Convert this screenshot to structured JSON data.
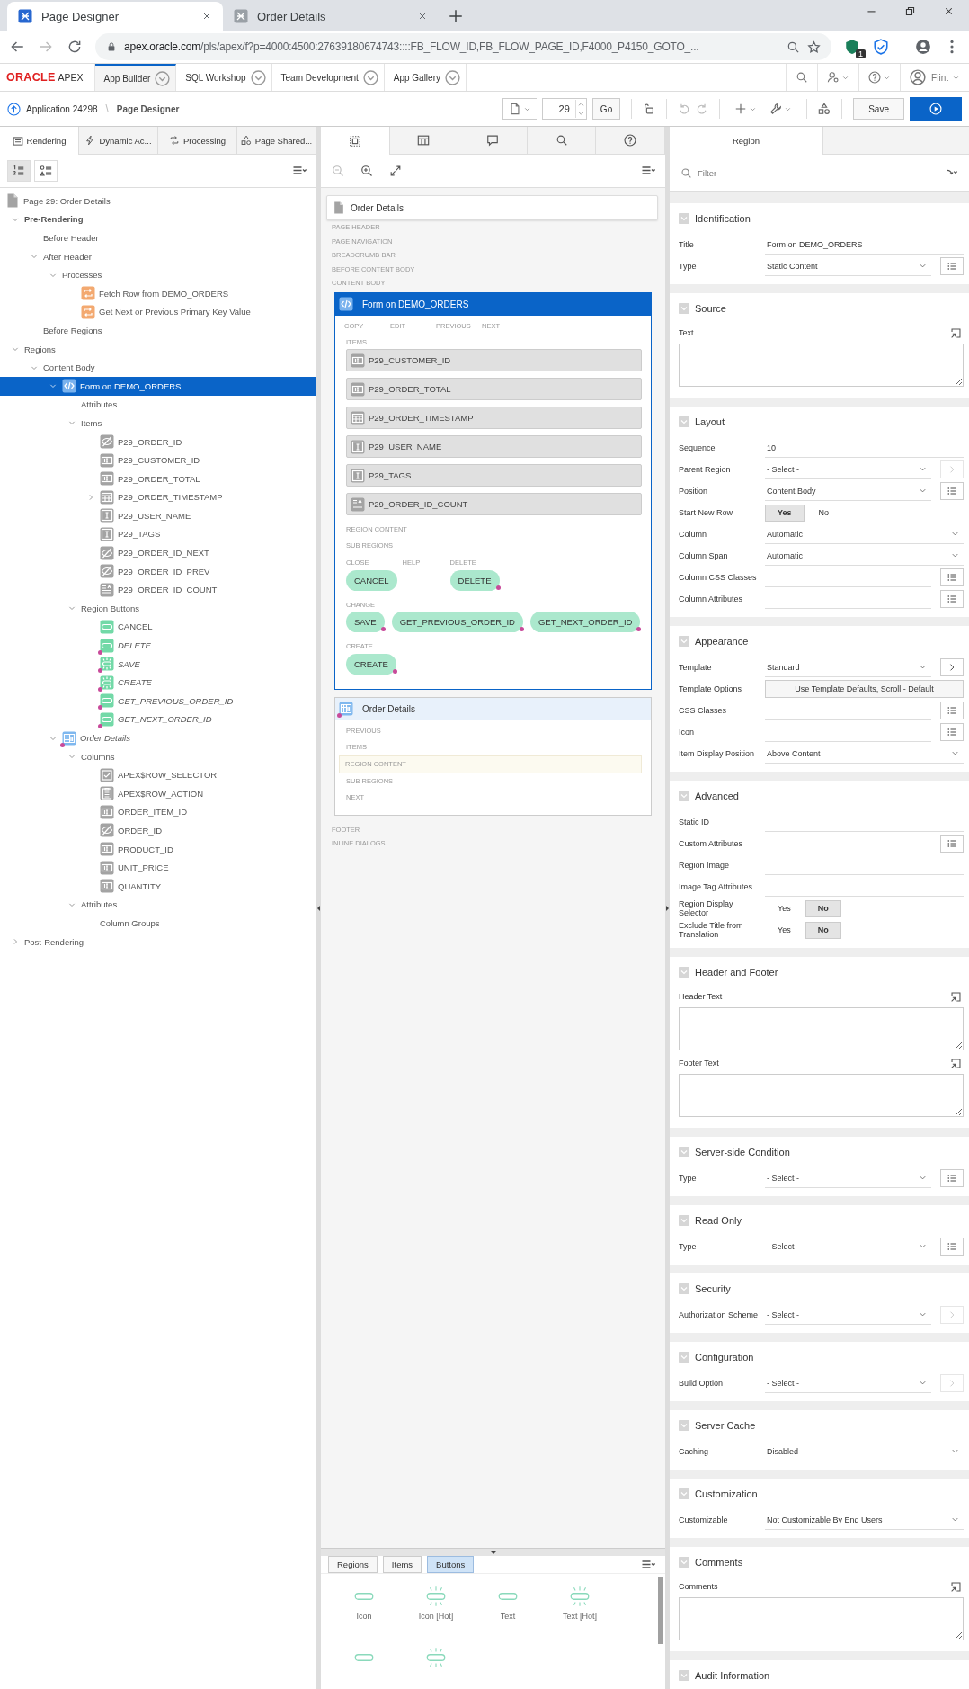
{
  "browser": {
    "tabs": [
      {
        "title": "Page Designer",
        "selected": true
      },
      {
        "title": "Order Details",
        "selected": false
      }
    ],
    "url_host": "apex.oracle.com",
    "url_path": "/pls/apex/f?p=4000:4500:27639180674743::::FB_FLOW_ID,FB_FLOW_PAGE_ID,F4000_P4150_GOTO_...",
    "extension_badge": "1"
  },
  "header": {
    "logo_brand": "ORACLE",
    "logo_product": "APEX",
    "menus": [
      {
        "label": "App Builder",
        "selected": true
      },
      {
        "label": "SQL Workshop",
        "selected": false
      },
      {
        "label": "Team Development",
        "selected": false
      },
      {
        "label": "App Gallery",
        "selected": false
      }
    ],
    "user": "Flint"
  },
  "toolbar": {
    "breadcrumb": [
      "Application 24298",
      "Page Designer"
    ],
    "separator": "\\",
    "page_number": "29",
    "go": "Go",
    "save": "Save"
  },
  "left": {
    "tabs": [
      {
        "label": "Rendering",
        "selected": true
      },
      {
        "label": "Dynamic Ac...",
        "selected": false
      },
      {
        "label": "Processing",
        "selected": false
      },
      {
        "label": "Page Shared...",
        "selected": false
      }
    ],
    "views": [
      {
        "selected": true
      },
      {
        "selected": false
      }
    ],
    "page": {
      "label": "Page 29: Order Details"
    },
    "tree": [
      {
        "label": "Pre-Rendering",
        "bold": true,
        "expanded": true,
        "selected": false,
        "children": [
          {
            "label": "Before Header",
            "selected": false
          },
          {
            "label": "After Header",
            "expanded": true,
            "selected": false,
            "children": [
              {
                "label": "Processes",
                "expanded": true,
                "selected": false,
                "children": [
                  {
                    "label": "Fetch Row from DEMO_ORDERS",
                    "kind": "process",
                    "selected": false
                  },
                  {
                    "label": "Get Next or Previous Primary Key Value",
                    "kind": "process",
                    "selected": false
                  }
                ]
              }
            ]
          },
          {
            "label": "Before Regions",
            "selected": false
          }
        ]
      },
      {
        "label": "Regions",
        "expanded": true,
        "selected": false,
        "children": [
          {
            "label": "Content Body",
            "expanded": true,
            "selected": false,
            "children": [
              {
                "label": "Form on DEMO_ORDERS",
                "kind": "code",
                "expanded": true,
                "selected": true,
                "children": [
                  {
                    "label": "Attributes",
                    "selected": false
                  },
                  {
                    "label": "Items",
                    "expanded": true,
                    "selected": false,
                    "children": [
                      {
                        "label": "P29_ORDER_ID",
                        "kind": "hidden",
                        "selected": false
                      },
                      {
                        "label": "P29_CUSTOMER_ID",
                        "kind": "number",
                        "selected": false
                      },
                      {
                        "label": "P29_ORDER_TOTAL",
                        "kind": "number",
                        "selected": false
                      },
                      {
                        "label": "P29_ORDER_TIMESTAMP",
                        "kind": "date",
                        "expanded": false,
                        "selected": false
                      },
                      {
                        "label": "P29_USER_NAME",
                        "kind": "text",
                        "selected": false
                      },
                      {
                        "label": "P29_TAGS",
                        "kind": "text",
                        "selected": false
                      },
                      {
                        "label": "P29_ORDER_ID_NEXT",
                        "kind": "hidden",
                        "selected": false
                      },
                      {
                        "label": "P29_ORDER_ID_PREV",
                        "kind": "hidden",
                        "selected": false
                      },
                      {
                        "label": "P29_ORDER_ID_COUNT",
                        "kind": "textarea",
                        "selected": false
                      }
                    ]
                  },
                  {
                    "label": "Region Buttons",
                    "expanded": true,
                    "selected": false,
                    "children": [
                      {
                        "label": "CANCEL",
                        "kind": "button",
                        "flag": false,
                        "selected": false
                      },
                      {
                        "label": "DELETE",
                        "kind": "button",
                        "flag": true,
                        "selected": false
                      },
                      {
                        "label": "SAVE",
                        "kind": "button-hot",
                        "flag": true,
                        "selected": false
                      },
                      {
                        "label": "CREATE",
                        "kind": "button-hot",
                        "flag": true,
                        "selected": false
                      },
                      {
                        "label": "GET_PREVIOUS_ORDER_ID",
                        "kind": "button",
                        "flag": true,
                        "selected": false
                      },
                      {
                        "label": "GET_NEXT_ORDER_ID",
                        "kind": "button",
                        "flag": true,
                        "selected": false
                      }
                    ]
                  }
                ]
              },
              {
                "label": "Order Details",
                "kind": "grid",
                "flag": true,
                "expanded": true,
                "selected": false,
                "children": [
                  {
                    "label": "Columns",
                    "expanded": true,
                    "selected": false,
                    "children": [
                      {
                        "label": "APEX$ROW_SELECTOR",
                        "kind": "checkbox",
                        "selected": false
                      },
                      {
                        "label": "APEX$ROW_ACTION",
                        "kind": "action",
                        "selected": false
                      },
                      {
                        "label": "ORDER_ITEM_ID",
                        "kind": "number",
                        "selected": false
                      },
                      {
                        "label": "ORDER_ID",
                        "kind": "hidden",
                        "selected": false
                      },
                      {
                        "label": "PRODUCT_ID",
                        "kind": "number",
                        "selected": false
                      },
                      {
                        "label": "UNIT_PRICE",
                        "kind": "number",
                        "selected": false
                      },
                      {
                        "label": "QUANTITY",
                        "kind": "number",
                        "selected": false
                      }
                    ]
                  },
                  {
                    "label": "Attributes",
                    "expanded": true,
                    "selected": false,
                    "children": [
                      {
                        "label": "Column Groups",
                        "selected": false
                      }
                    ]
                  }
                ]
              }
            ]
          }
        ]
      },
      {
        "label": "Post-Rendering",
        "expanded": false,
        "selected": false
      }
    ]
  },
  "middle": {
    "tabs": [
      {
        "selected": true
      },
      {
        "selected": false
      },
      {
        "selected": false
      },
      {
        "selected": false
      },
      {
        "selected": false
      }
    ],
    "page_box": "Order Details",
    "positions_top": [
      "PAGE HEADER",
      "PAGE NAVIGATION",
      "BREADCRUMB BAR",
      "BEFORE CONTENT BODY",
      "CONTENT BODY"
    ],
    "regions": [
      {
        "title": "Form on DEMO_ORDERS",
        "kind": "code",
        "selected": true,
        "flag": false,
        "top_positions": [
          "COPY",
          "EDIT",
          "PREVIOUS",
          "NEXT"
        ],
        "items_label": "ITEMS",
        "items": [
          {
            "label": "P29_CUSTOMER_ID",
            "kind": "number"
          },
          {
            "label": "P29_ORDER_TOTAL",
            "kind": "number"
          },
          {
            "label": "P29_ORDER_TIMESTAMP",
            "kind": "date"
          },
          {
            "label": "P29_USER_NAME",
            "kind": "text"
          },
          {
            "label": "P29_TAGS",
            "kind": "text"
          },
          {
            "label": "P29_ORDER_ID_COUNT",
            "kind": "textarea"
          }
        ],
        "sections": [
          {
            "label": "REGION CONTENT",
            "highlighted": false
          },
          {
            "label": "SUB REGIONS",
            "highlighted": false
          }
        ],
        "button_rows": [
          [
            {
              "position": "CLOSE",
              "buttons": [
                {
                  "label": "CANCEL",
                  "flag": false
                }
              ]
            },
            {
              "position": "HELP"
            },
            {
              "position": "DELETE",
              "buttons": [
                {
                  "label": "DELETE",
                  "flag": true
                }
              ]
            }
          ],
          [
            {
              "position": "CHANGE",
              "buttons": [
                {
                  "label": "SAVE",
                  "flag": true
                },
                {
                  "label": "GET_PREVIOUS_ORDER_ID",
                  "flag": true
                },
                {
                  "label": "GET_NEXT_ORDER_ID",
                  "flag": true
                }
              ]
            }
          ],
          [
            {
              "position": "CREATE",
              "buttons": [
                {
                  "label": "CREATE",
                  "flag": true
                }
              ]
            }
          ]
        ]
      },
      {
        "title": "Order Details",
        "kind": "grid",
        "selected": false,
        "flag": true,
        "sections": [
          {
            "label": "PREVIOUS",
            "highlighted": false
          },
          {
            "label": "ITEMS",
            "highlighted": false
          },
          {
            "label": "REGION CONTENT",
            "highlighted": true
          },
          {
            "label": "SUB REGIONS",
            "highlighted": false
          },
          {
            "label": "NEXT",
            "highlighted": false
          }
        ]
      }
    ],
    "positions_bottom": [
      "FOOTER",
      "INLINE DIALOGS"
    ],
    "gallery": {
      "tabs": [
        {
          "label": "Regions",
          "selected": false
        },
        {
          "label": "Items",
          "selected": false
        },
        {
          "label": "Buttons",
          "selected": true
        }
      ],
      "tiles": [
        {
          "label": "Icon",
          "hot": false
        },
        {
          "label": "Icon [Hot]",
          "hot": true
        },
        {
          "label": "Text",
          "hot": false
        },
        {
          "label": "Text [Hot]",
          "hot": true
        },
        {
          "hot": false
        },
        {
          "hot": true
        }
      ]
    }
  },
  "properties": {
    "tabs": [
      {
        "label": "Region",
        "selected": true
      }
    ],
    "filter_placeholder": "Filter",
    "groups": [
      {
        "title": "Identification",
        "expanded": true,
        "rows": [
          {
            "kind": "text",
            "label": "Title",
            "value": "Form on DEMO_ORDERS"
          },
          {
            "kind": "select",
            "label": "Type",
            "value": "Static Content",
            "side": {
              "kind": "list",
              "disabled": false
            }
          }
        ]
      },
      {
        "title": "Source",
        "expanded": true,
        "rows": [
          {
            "kind": "textarea",
            "label": "Text"
          }
        ]
      },
      {
        "title": "Layout",
        "expanded": true,
        "rows": [
          {
            "kind": "text",
            "label": "Sequence",
            "value": "10"
          },
          {
            "kind": "select",
            "label": "Parent Region",
            "value": "- Select -",
            "side": {
              "kind": "arrow",
              "disabled": true
            }
          },
          {
            "kind": "select",
            "label": "Position",
            "value": "Content Body",
            "side": {
              "kind": "list",
              "disabled": false
            }
          },
          {
            "kind": "toggle",
            "label": "Start New Row",
            "options": [
              {
                "label": "Yes",
                "selected": true
              },
              {
                "label": "No",
                "selected": false
              }
            ]
          },
          {
            "kind": "select",
            "label": "Column",
            "value": "Automatic"
          },
          {
            "kind": "select",
            "label": "Column Span",
            "value": "Automatic"
          },
          {
            "kind": "text",
            "label": "Column CSS Classes",
            "side": {
              "kind": "list",
              "disabled": false
            }
          },
          {
            "kind": "text",
            "label": "Column Attributes",
            "side": {
              "kind": "list",
              "disabled": false
            }
          }
        ]
      },
      {
        "title": "Appearance",
        "expanded": true,
        "rows": [
          {
            "kind": "select",
            "label": "Template",
            "value": "Standard",
            "side": {
              "kind": "arrow",
              "disabled": false
            }
          },
          {
            "kind": "button",
            "label": "Template Options",
            "value": "Use Template Defaults, Scroll - Default"
          },
          {
            "kind": "text",
            "label": "CSS Classes",
            "side": {
              "kind": "list",
              "disabled": false
            }
          },
          {
            "kind": "text",
            "label": "Icon",
            "side": {
              "kind": "list",
              "disabled": false
            }
          },
          {
            "kind": "select",
            "label": "Item Display Position",
            "value": "Above Content"
          }
        ]
      },
      {
        "title": "Advanced",
        "expanded": true,
        "rows": [
          {
            "kind": "text",
            "label": "Static ID"
          },
          {
            "kind": "text",
            "label": "Custom Attributes",
            "side": {
              "kind": "list",
              "disabled": false
            }
          },
          {
            "kind": "text",
            "label": "Region Image"
          },
          {
            "kind": "text",
            "label": "Image Tag Attributes"
          },
          {
            "kind": "toggle",
            "label": "Region Display Selector",
            "options": [
              {
                "label": "Yes",
                "selected": false
              },
              {
                "label": "No",
                "selected": true
              }
            ]
          },
          {
            "kind": "toggle",
            "label": "Exclude Title from Translation",
            "options": [
              {
                "label": "Yes",
                "selected": false
              },
              {
                "label": "No",
                "selected": true
              }
            ]
          }
        ]
      },
      {
        "title": "Header and Footer",
        "expanded": true,
        "rows": [
          {
            "kind": "textarea",
            "label": "Header Text"
          },
          {
            "kind": "textarea",
            "label": "Footer Text"
          }
        ]
      },
      {
        "title": "Server-side Condition",
        "expanded": true,
        "rows": [
          {
            "kind": "select",
            "label": "Type",
            "value": "- Select -",
            "side": {
              "kind": "list",
              "disabled": false
            }
          }
        ]
      },
      {
        "title": "Read Only",
        "expanded": true,
        "rows": [
          {
            "kind": "select",
            "label": "Type",
            "value": "- Select -",
            "side": {
              "kind": "list",
              "disabled": false
            }
          }
        ]
      },
      {
        "title": "Security",
        "expanded": true,
        "rows": [
          {
            "kind": "select",
            "label": "Authorization Scheme",
            "value": "- Select -",
            "side": {
              "kind": "arrow",
              "disabled": true
            }
          }
        ]
      },
      {
        "title": "Configuration",
        "expanded": true,
        "rows": [
          {
            "kind": "select",
            "label": "Build Option",
            "value": "- Select -",
            "side": {
              "kind": "arrow",
              "disabled": true
            }
          }
        ]
      },
      {
        "title": "Server Cache",
        "expanded": true,
        "rows": [
          {
            "kind": "select",
            "label": "Caching",
            "value": "Disabled"
          }
        ]
      },
      {
        "title": "Customization",
        "expanded": true,
        "rows": [
          {
            "kind": "select",
            "label": "Customizable",
            "value": "Not Customizable By End Users"
          }
        ]
      },
      {
        "title": "Comments",
        "expanded": true,
        "rows": [
          {
            "kind": "textarea",
            "label": "Comments"
          }
        ]
      },
      {
        "title": "Audit Information",
        "expanded": true
      }
    ]
  }
}
